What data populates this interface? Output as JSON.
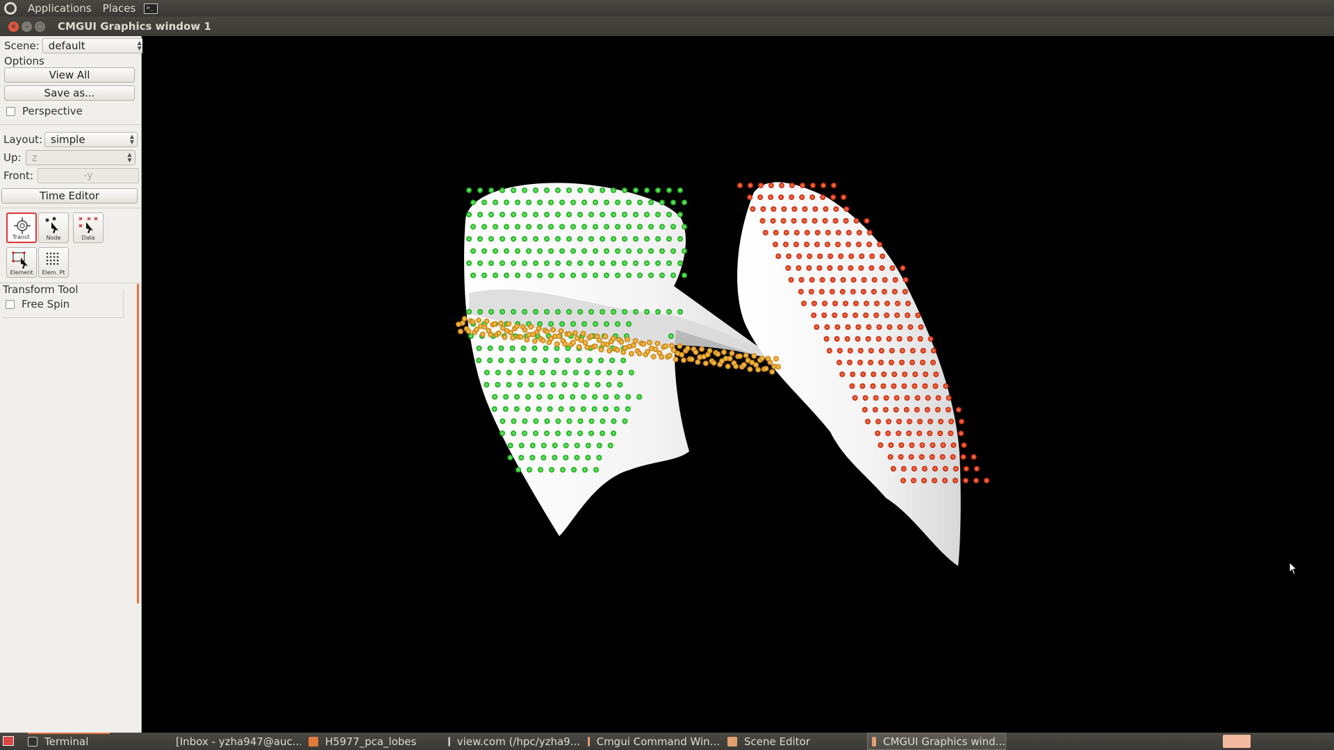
{
  "top_panel": {
    "applications_label": "Applications",
    "places_label": "Places"
  },
  "window": {
    "title": "CMGUI Graphics window 1"
  },
  "left_panel": {
    "scene_label": "Scene:",
    "scene_value": "default",
    "options_label": "Options",
    "view_all_label": "View All",
    "save_as_label": "Save as...",
    "perspective_label": "Perspective",
    "perspective_checked": false,
    "layout_label": "Layout:",
    "layout_value": "simple",
    "up_label": "Up:",
    "up_value": "z",
    "front_label": "Front:",
    "front_value": "-y",
    "time_editor_label": "Time Editor",
    "tools": [
      {
        "label": "Transf.",
        "icon": "transform-icon",
        "active": true
      },
      {
        "label": "Node",
        "icon": "node-tool-icon",
        "active": false
      },
      {
        "label": "Data",
        "icon": "data-tool-icon",
        "active": false
      },
      {
        "label": "Element",
        "icon": "element-tool-icon",
        "active": false
      },
      {
        "label": "Elem. Pt",
        "icon": "element-point-tool-icon",
        "active": false
      }
    ],
    "transform_tool_label": "Transform Tool",
    "free_spin_label": "Free Spin",
    "free_spin_checked": false
  },
  "scene": {
    "colors": {
      "background": "#000000",
      "surface": "#ffffff",
      "left_lobe_points": "#1ec41e",
      "right_lobe_points": "#e0330f",
      "fissure_points": "#e8a21a"
    }
  },
  "taskbar": {
    "items": [
      {
        "label": "Terminal",
        "icon": "terminal-icon"
      },
      {
        "label": "[Inbox - yzha947@auc...",
        "icon": "firefox-icon"
      },
      {
        "label": "H5977_pca_lobes",
        "icon": "folder-icon"
      },
      {
        "label": "view.com (/hpc/yzha9...",
        "icon": "text-editor-icon"
      },
      {
        "label": "Cmgui Command Win...",
        "icon": "cmgui-icon"
      },
      {
        "label": "Scene Editor",
        "icon": "cmgui-icon"
      },
      {
        "label": "CMGUI Graphics wind...",
        "icon": "cmgui-icon"
      }
    ]
  }
}
